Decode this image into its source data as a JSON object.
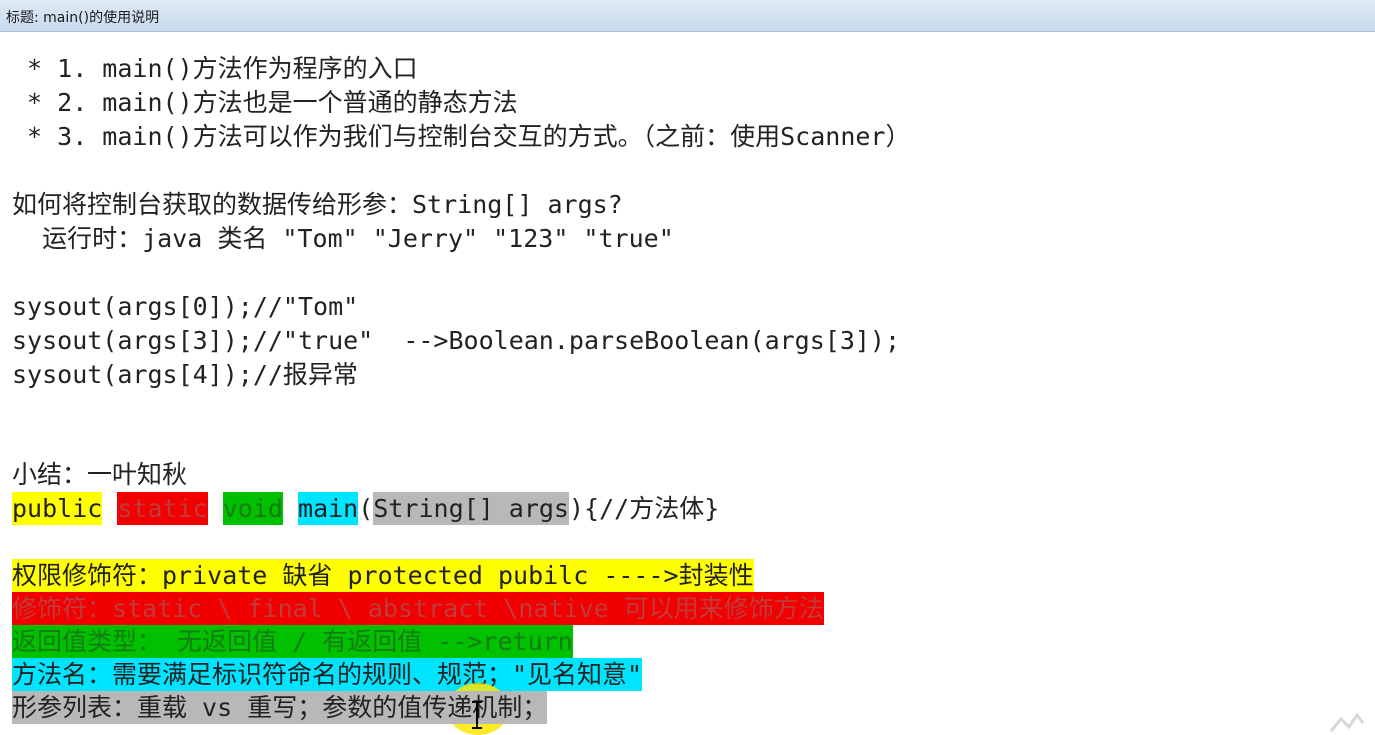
{
  "window": {
    "title": "标题: main()的使用说明"
  },
  "notes": {
    "points": [
      " * 1. main()方法作为程序的入口",
      " * 2. main()方法也是一个普通的静态方法",
      " * 3. main()方法可以作为我们与控制台交互的方式。（之前：使用Scanner）"
    ],
    "question": "如何将控制台获取的数据传给形参：String[] args?",
    "run_example": "  运行时：java 类名 \"Tom\" \"Jerry\" \"123\" \"true\"",
    "code": [
      "sysout(args[0]);//\"Tom\"",
      "sysout(args[3]);//\"true\"  -->Boolean.parseBoolean(args[3]);",
      "sysout(args[4]);//报异常"
    ],
    "summary_title": "小结：一叶知秋",
    "signature": {
      "public": "public",
      "static": "static",
      "void": "void",
      "main": "main",
      "open_paren": "(",
      "params": "String[] args",
      "rest": "){//方法体}"
    },
    "explanations": [
      "权限修饰符：private 缺省 protected pubilc ---->封装性",
      "修饰符：static \\ final \\ abstract \\native 可以用来修饰方法",
      "返回值类型： 无返回值 / 有返回值 -->return",
      "方法名：需要满足标识符命名的规则、规范；\"见名知意\"",
      "形参列表：重载 vs 重写；参数的值传递机制；"
    ]
  },
  "colors": {
    "yellow": "#ffff00",
    "red": "#f00000",
    "green": "#00c000",
    "cyan": "#00e5ff",
    "gray": "#b8b8b8"
  },
  "icons": {
    "cursor": "text-cursor-icon"
  }
}
